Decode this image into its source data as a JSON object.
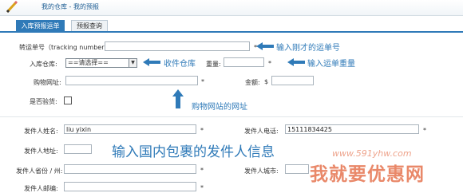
{
  "header": {
    "breadcrumb": "我的仓库 - 我的预报"
  },
  "tabs": [
    {
      "label": "入库预报运单",
      "active": true
    },
    {
      "label": "预报查询",
      "active": false
    }
  ],
  "form": {
    "tracking_label": "转运单号（tracking number):",
    "warehouse_label": "入库仓库:",
    "warehouse_selected": "==请选择==",
    "weight_label": "重量:",
    "shop_url_label": "购物网址:",
    "amount_label": "金额:",
    "currency_symbol": "$",
    "inspection_label": "是否验货:",
    "sender_name_label": "发件人姓名:",
    "sender_name_value": "liu yixin",
    "sender_phone_label": "发件人电话:",
    "sender_phone_value": "15111834425",
    "sender_address_label": "发件人地址:",
    "sender_province_label": "发件人省份 / 州:",
    "sender_city_label": "发件人城市:",
    "sender_zip_label": "发件人邮编:",
    "required_mark": "*"
  },
  "annotations": {
    "tracking_hint": "输入刚才的运单号",
    "warehouse_hint": "收件仓库",
    "weight_hint": "输入运单重量",
    "shop_hint": "购物网站的网址",
    "sender_hint": "输入国内包裹的发件人信息"
  },
  "watermark": {
    "url": "www.591yhw.com",
    "text": "我就要优惠网"
  },
  "colors": {
    "accent": "#2f7ab8",
    "watermark": "#e0572b"
  }
}
